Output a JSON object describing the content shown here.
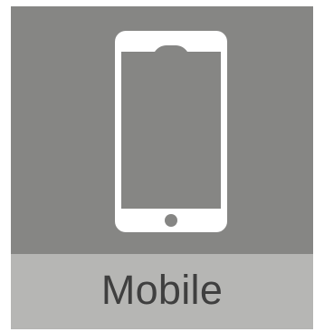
{
  "tile": {
    "label": "Mobile",
    "icon": "mobile-phone-icon",
    "colors": {
      "icon_area": "#868684",
      "label_area": "#b6b6b4",
      "label_text": "#3f3f3f",
      "icon_fill": "#ffffff"
    }
  }
}
